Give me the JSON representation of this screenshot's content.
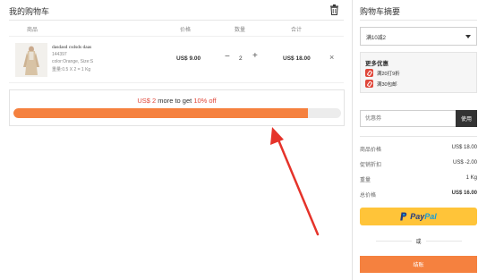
{
  "cart": {
    "title": "我的购物车",
    "headers": {
      "product": "商品",
      "price": "价格",
      "quantity": "数量",
      "total": "合计"
    },
    "item": {
      "name": "dasdasd csdsds daas",
      "sku": "144397",
      "attributes": "color:Orange, Size:S",
      "weight": "重量:0.5 X 2 = 1 Kg",
      "price": "US$ 9.00",
      "quantity": "2",
      "total": "US$ 18.00",
      "minus_symbol": "−",
      "plus_symbol": "+",
      "remove_symbol": "×"
    },
    "promo": {
      "amount": "US$ 2",
      "middle": " more to get ",
      "discount": "10% off",
      "progress_percent": 90
    }
  },
  "summary": {
    "title": "购物车摘要",
    "select_value": "满10减2",
    "more_offers_title": "更多优惠",
    "offers": [
      "满20打9折",
      "满30包邮"
    ],
    "coupon_placeholder": "优惠券",
    "coupon_button": "使用",
    "lines": [
      {
        "label": "商品价格",
        "value": "US$ 18.00"
      },
      {
        "label": "促销折扣",
        "value": "US$ -2.00"
      },
      {
        "label": "重量",
        "value": "1 Kg"
      },
      {
        "label": "总价格",
        "value": "US$ 16.00"
      }
    ],
    "paypal_pay": "Pay",
    "paypal_pal": "Pal",
    "or_text": "或",
    "checkout_button": "结账"
  },
  "colors": {
    "accent": "#f5813f",
    "promo_red": "#e0473a",
    "paypal_yellow": "#ffc439"
  },
  "icons": {
    "trash": "trash-icon",
    "remove": "close-icon",
    "offer_tag": "tag-icon",
    "paypal": "paypal-logo",
    "annotation": "red-arrow"
  }
}
